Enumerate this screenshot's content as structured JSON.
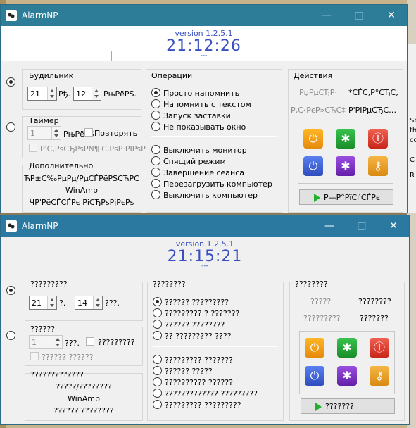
{
  "app": {
    "title": "AlarmNP",
    "version": "version 1.2.5.1",
    "dashes": "---"
  },
  "win1": {
    "clock": "21:12:26",
    "alarm": {
      "title": "Будильник",
      "hours": "21",
      "hours_unit": "Рђ.",
      "minutes": "12",
      "minutes_unit": "РњРёРЅ."
    },
    "timer": {
      "title": "Таймер",
      "value": "1",
      "unit": "РњРёРЅ",
      "repeat_label": "Повторять",
      "disabled_option": "Р'С‚РѕСЂРѕРN¶ С‚РѕР·РІРѕРЅ"
    },
    "extra": {
      "title": "Дополнительно",
      "line1": "ЋР±С‰РµРµ/РµСЃРёРЅСЋРС",
      "line2": "WinAmp",
      "line3": "ЧР'РёСЃСЃРє РіСЂРѕРјРєРѕ"
    },
    "ops": {
      "title": "Операции",
      "items": [
        "Просто напомнить",
        "Напомнить с текстом",
        "Запуск заставки",
        "Не показывать окно"
      ],
      "items2": [
        "Выключить монитор",
        "Спящий режим",
        "Завершение сеанса",
        "Перезагрузить компьютер",
        "Выключить компьютер"
      ]
    },
    "actions": {
      "title": "Действия",
      "r1a": "РџРµСЂР·",
      "r1b": "*СЃС‚Р°СЂС‚",
      "r2a": "Р‚С‹РєР»СЋС‡",
      "r2b": "Р'РІРµСЂС…",
      "button": "Р—Р°РїСѓСЃРє"
    }
  },
  "win2": {
    "clock": "21:15:21",
    "alarm": {
      "title": "?????????",
      "hours": "21",
      "hours_unit": "?.",
      "minutes": "14",
      "minutes_unit": "???."
    },
    "timer": {
      "title": "??????",
      "value": "1",
      "unit": "???.",
      "repeat_label": "?????????",
      "disabled_option": "?????? ??????"
    },
    "extra": {
      "title": "?????????????",
      "line1": "?????/????????",
      "line2": "WinAmp",
      "line3": "?????? ????????"
    },
    "ops": {
      "title": "????????",
      "items": [
        "?????? ?????????",
        "????????? ? ???????",
        "?????? ????????",
        "?? ????????? ????"
      ],
      "items2": [
        "????????? ???????",
        "?????? ?????",
        "?????????? ??????",
        "????????????? ?????????",
        "????????? ?????????"
      ]
    },
    "actions": {
      "title": "????????",
      "r1a": "?????",
      "r1b": "????????",
      "r2a": "?????????",
      "r2b": "???????",
      "button": "???????"
    }
  },
  "desktop": {
    "side_text": [
      "Se",
      "th",
      "co",
      "C",
      "R"
    ]
  }
}
